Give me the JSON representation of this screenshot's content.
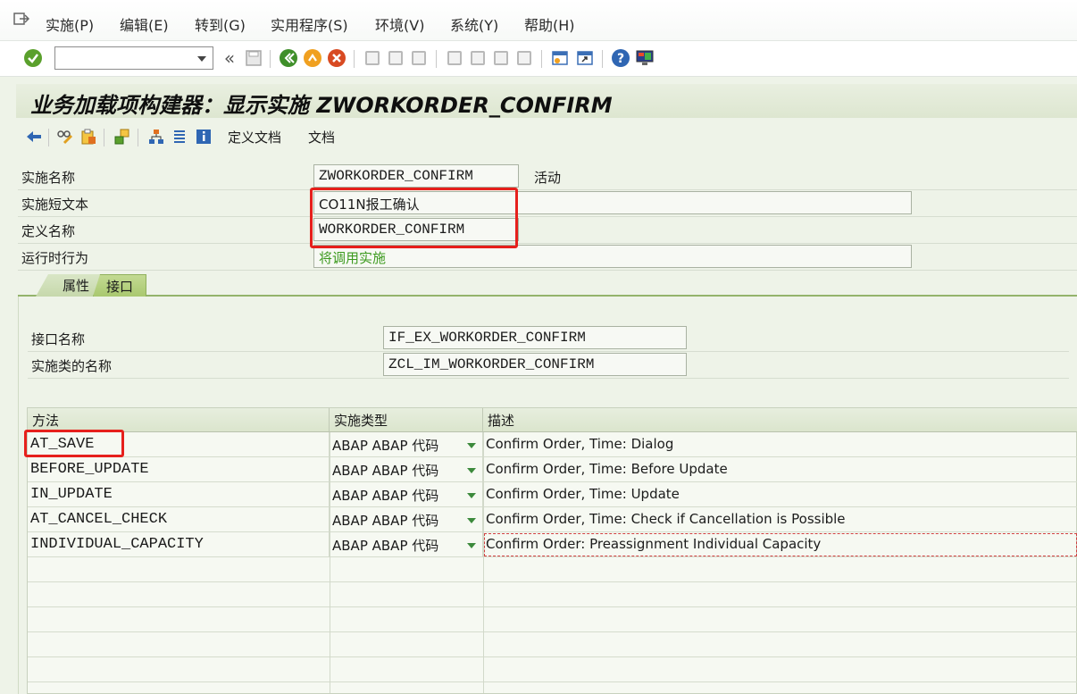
{
  "menu": {
    "items": [
      "实施(P)",
      "编辑(E)",
      "转到(G)",
      "实用程序(S)",
      "环境(V)",
      "系统(Y)",
      "帮助(H)"
    ]
  },
  "toolbar": {
    "command_value": "",
    "back_glyph": "«"
  },
  "page_title": "业务加载项构建器：显示实施 ZWORKORDER_CONFIRM",
  "app_toolbar": {
    "define_doc_label": "定义文档",
    "doc_label": "文档"
  },
  "header": {
    "impl_name_label": "实施名称",
    "impl_name_value": "ZWORKORDER_CONFIRM",
    "status": "活动",
    "short_text_label": "实施短文本",
    "short_text_value": "CO11N报工确认",
    "def_name_label": "定义名称",
    "def_name_value": "WORKORDER_CONFIRM",
    "runtime_label": "运行时行为",
    "runtime_value": "将调用实施"
  },
  "tabs": {
    "attributes": "属性",
    "interface": "接口"
  },
  "interface": {
    "name_label": "接口名称",
    "name_value": "IF_EX_WORKORDER_CONFIRM",
    "class_label": "实施类的名称",
    "class_value": "ZCL_IM_WORKORDER_CONFIRM"
  },
  "table": {
    "headers": [
      "方法",
      "实施类型",
      "描述"
    ],
    "rows": [
      {
        "method": "AT_SAVE",
        "type": "ABAP ABAP 代码",
        "desc": "Confirm Order, Time: Dialog"
      },
      {
        "method": "BEFORE_UPDATE",
        "type": "ABAP ABAP 代码",
        "desc": "Confirm Order, Time: Before Update"
      },
      {
        "method": "IN_UPDATE",
        "type": "ABAP ABAP 代码",
        "desc": "Confirm Order, Time: Update"
      },
      {
        "method": "AT_CANCEL_CHECK",
        "type": "ABAP ABAP 代码",
        "desc": "Confirm Order, Time: Check if Cancellation is Possible"
      },
      {
        "method": "INDIVIDUAL_CAPACITY",
        "type": "ABAP ABAP 代码",
        "desc": "Confirm Order: Preassignment Individual Capacity"
      }
    ]
  },
  "colors": {
    "highlight": "#e6201c",
    "accent_green": "#3c9a1e",
    "panel_bg": "#eef3e8"
  }
}
